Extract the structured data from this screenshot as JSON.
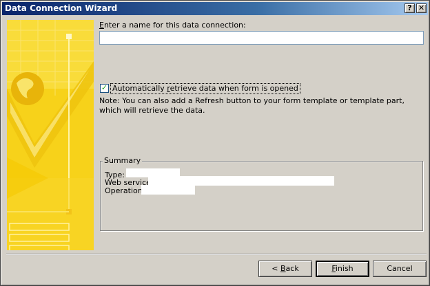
{
  "window": {
    "title": "Data Connection Wizard",
    "help_glyph": "?",
    "close_glyph": "✕"
  },
  "form": {
    "name_label_prefix": "",
    "name_label_u": "E",
    "name_label_rest": "nter a name for this data connection:",
    "name_value": "",
    "auto_retrieve_checked": true,
    "auto_retrieve_pre": "Automatically ",
    "auto_retrieve_u": "r",
    "auto_retrieve_post": "etrieve data when form is opened",
    "note": "Note: You can also add a Refresh button to your form template or template part, which will retrieve the data."
  },
  "summary": {
    "legend": "Summary",
    "type_label": "Type:",
    "service_label": "Web service:",
    "operation_label": "Operation:"
  },
  "buttons": {
    "back_pre": "< ",
    "back_u": "B",
    "back_post": "ack",
    "finish_u": "F",
    "finish_post": "inish",
    "cancel": "Cancel"
  },
  "colors": {
    "side_panel": "#f7d21a",
    "title_start": "#0a246a"
  }
}
